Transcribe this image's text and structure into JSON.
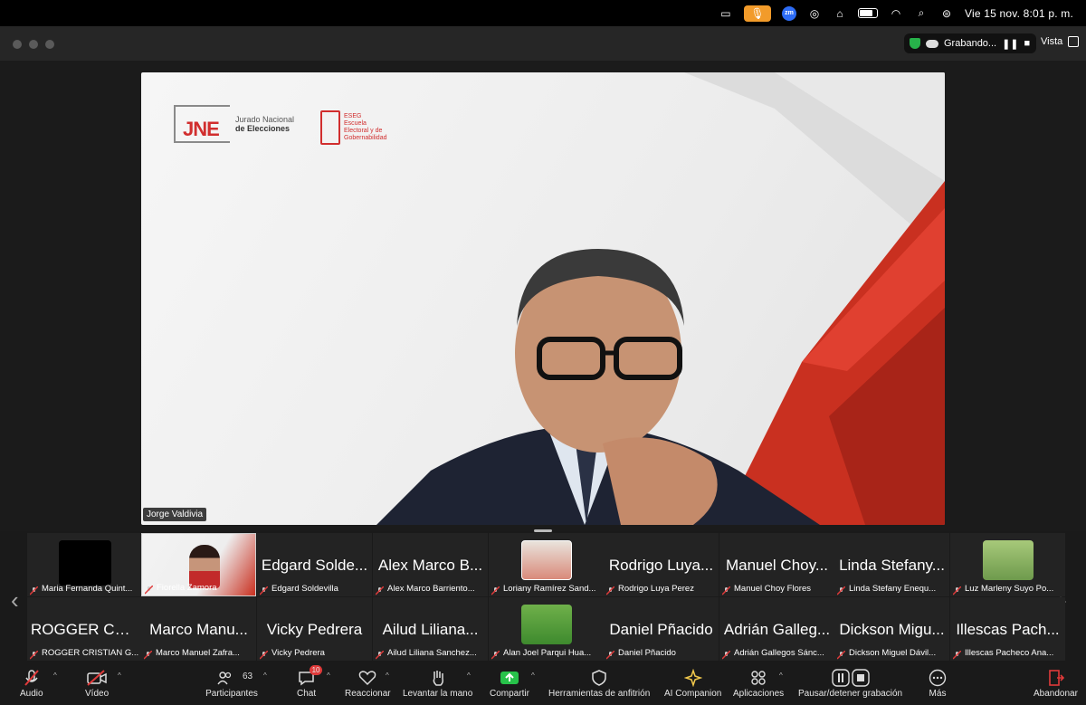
{
  "menubar": {
    "datetime": "Vie 15 nov.  8:01 p. m.",
    "zoom_badge": "zm"
  },
  "window": {
    "recording_label": "Grabando...",
    "view_label": "Vista"
  },
  "main_video": {
    "speaker_name": "Jorge Valdivia",
    "logo_jne_line1": "Jurado Nacional",
    "logo_jne_line2": "de Elecciones",
    "logo_jne_letters": "JNE",
    "logo_esg_lines": [
      "ESEG",
      "Escuela",
      "Electoral y de",
      "Gobernabilidad"
    ]
  },
  "participants": [
    {
      "big": "",
      "label": "Maria Fernanda Quint..."
    },
    {
      "big": "",
      "label": "Fiorella Zamora"
    },
    {
      "big": "Edgard Solde...",
      "label": "Edgard Soldevilla"
    },
    {
      "big": "Alex Marco B...",
      "label": "Alex Marco Barriento..."
    },
    {
      "big": "",
      "label": "Loriany Ramírez Sand..."
    },
    {
      "big": "Rodrigo Luya...",
      "label": "Rodrigo Luya Perez"
    },
    {
      "big": "Manuel Choy...",
      "label": "Manuel Choy Flores"
    },
    {
      "big": "Linda Stefany...",
      "label": "Linda Stefany Enequ..."
    },
    {
      "big": "",
      "label": "Luz Marleny Suyo Po..."
    },
    {
      "big": "ROGGER CRI...",
      "label": "ROGGER CRISTIAN G..."
    },
    {
      "big": "Marco Manu...",
      "label": "Marco Manuel Zafra..."
    },
    {
      "big": "Vicky Pedrera",
      "label": "Vicky Pedrera"
    },
    {
      "big": "Ailud Liliana...",
      "label": "Ailud Liliana Sanchez..."
    },
    {
      "big": "",
      "label": "Alan Joel  Parqui Hua..."
    },
    {
      "big": "Daniel Pñacido",
      "label": "Daniel Pñacido"
    },
    {
      "big": "Adrián Galleg...",
      "label": "Adrián Gallegos Sánc..."
    },
    {
      "big": "Dickson Migu...",
      "label": "Dickson Miguel Dávil..."
    },
    {
      "big": "Illescas Pach...",
      "label": "Illescas Pacheco Ana..."
    }
  ],
  "toolbar": {
    "audio": "Audio",
    "video": "Vídeo",
    "participants": "Participantes",
    "participants_count": "63",
    "chat": "Chat",
    "chat_badge": "10",
    "react": "Reaccionar",
    "raise_hand": "Levantar la mano",
    "share": "Compartir",
    "host_tools": "Herramientas de anfitrión",
    "ai": "AI Companion",
    "apps": "Aplicaciones",
    "recording": "Pausar/detener grabación",
    "more": "Más",
    "leave": "Abandonar"
  },
  "colors": {
    "accent_red": "#d12e2e",
    "share_green": "#27c24a",
    "mic_orange": "#f29b2a"
  }
}
